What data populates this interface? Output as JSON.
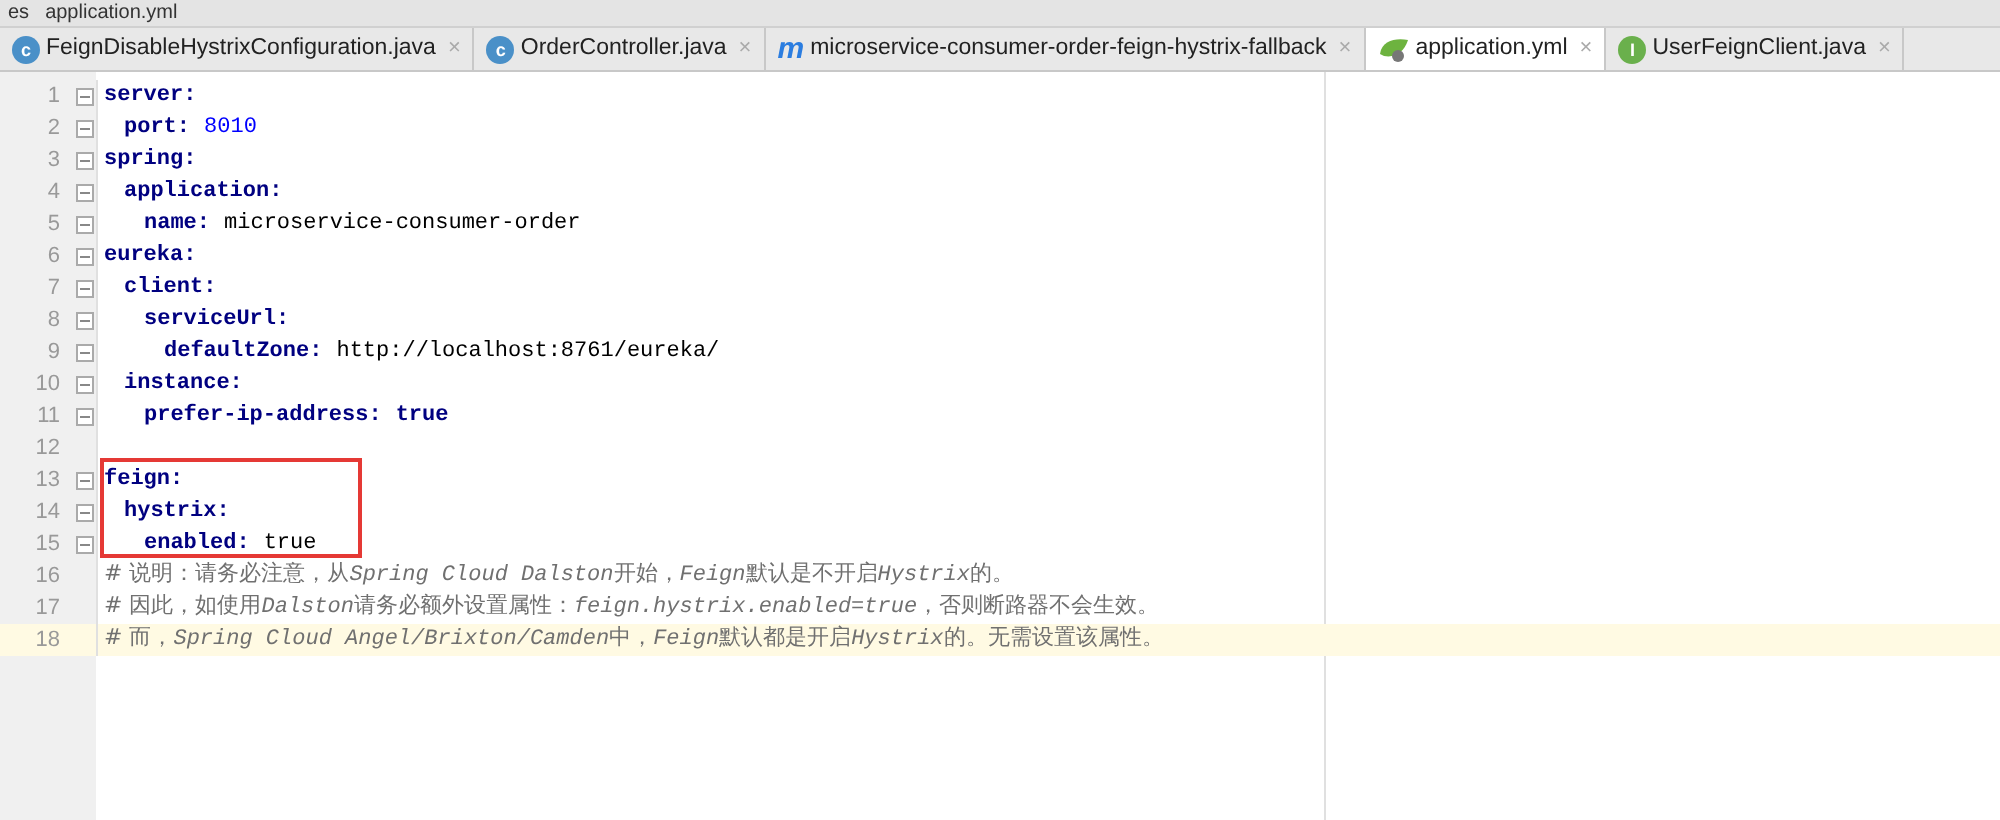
{
  "breadcrumb": [
    "es",
    "application.yml"
  ],
  "tabs": [
    {
      "label": "FeignDisableHystrixConfiguration.java",
      "kind": "class",
      "icon_text": "c",
      "close": "×",
      "selected": false
    },
    {
      "label": "OrderController.java",
      "kind": "class",
      "icon_text": "c",
      "close": "×",
      "selected": false
    },
    {
      "label": "microservice-consumer-order-feign-hystrix-fallback",
      "kind": "module",
      "icon_text": "m",
      "close": "×",
      "selected": false
    },
    {
      "label": "application.yml",
      "kind": "yml",
      "close": "×",
      "selected": true
    },
    {
      "label": "UserFeignClient.java",
      "kind": "interface",
      "icon_text": "I",
      "close": "×",
      "selected": false
    }
  ],
  "code": [
    {
      "kind": "node",
      "number": "1",
      "key": "server:",
      "current": false,
      "highlighted": false,
      "children": [
        {
          "kind": "node",
          "number": "2",
          "key": "port:",
          "value": {
            "text": "8010",
            "kind": "number"
          },
          "current": false
        }
      ]
    },
    {
      "kind": "node",
      "number": "3",
      "key": "spring:",
      "current": false,
      "highlighted": false,
      "children": [
        {
          "kind": "node",
          "number": "4",
          "key": "application:",
          "current": false,
          "children": [
            {
              "kind": "node",
              "number": "5",
              "key": "name:",
              "value": {
                "text": "microservice-consumer-order",
                "kind": "plain"
              },
              "current": false
            }
          ]
        }
      ]
    },
    {
      "kind": "node",
      "number": "6",
      "key": "eureka:",
      "current": false,
      "highlighted": false,
      "children": [
        {
          "kind": "node",
          "number": "7",
          "key": "client:",
          "current": false,
          "children": [
            {
              "kind": "node",
              "number": "8",
              "key": "serviceUrl:",
              "current": false,
              "children": [
                {
                  "kind": "node",
                  "number": "9",
                  "key": "defaultZone:",
                  "value": {
                    "text": "http://localhost:8761/eureka/",
                    "kind": "plain"
                  },
                  "current": false
                }
              ]
            }
          ]
        },
        {
          "kind": "node",
          "number": "10",
          "key": "instance:",
          "current": false,
          "children": [
            {
              "kind": "node",
              "number": "11",
              "key": "prefer-ip-address:",
              "value": {
                "text": "true",
                "kind": "keyword"
              },
              "current": false
            }
          ]
        }
      ]
    },
    {
      "kind": "blank",
      "number": "12",
      "current": false,
      "highlighted": false
    },
    {
      "kind": "node",
      "number": "13",
      "key": "feign:",
      "current": false,
      "highlighted": true,
      "children": [
        {
          "kind": "node",
          "number": "14",
          "key": "hystrix:",
          "current": false,
          "children": [
            {
              "kind": "node",
              "number": "15",
              "key": "enabled:",
              "value": {
                "text": "true",
                "kind": "plain"
              },
              "current": false
            }
          ]
        }
      ]
    },
    {
      "kind": "comment",
      "number": "16",
      "segments": [
        {
          "text": "# 说明：请务必注意，从",
          "italic": false
        },
        {
          "text": "Spring Cloud Dalston",
          "italic": true
        },
        {
          "text": "开始，",
          "italic": false
        },
        {
          "text": "Feign",
          "italic": true
        },
        {
          "text": "默认是不开启",
          "italic": false
        },
        {
          "text": "Hystrix",
          "italic": true
        },
        {
          "text": "的。",
          "italic": false
        }
      ],
      "current": false,
      "highlighted": false
    },
    {
      "kind": "comment",
      "number": "17",
      "segments": [
        {
          "text": "# 因此，如使用",
          "italic": false
        },
        {
          "text": "Dalston",
          "italic": true
        },
        {
          "text": "请务必额外设置属性：",
          "italic": false
        },
        {
          "text": "feign.hystrix.enabled=true",
          "italic": true
        },
        {
          "text": "，否则断路器不会生效。",
          "italic": false
        }
      ],
      "current": false,
      "highlighted": false
    },
    {
      "kind": "comment",
      "number": "18",
      "segments": [
        {
          "text": "# 而，",
          "italic": false
        },
        {
          "text": "Spring Cloud Angel/Brixton/Camden",
          "italic": true
        },
        {
          "text": "中，",
          "italic": false
        },
        {
          "text": "Feign",
          "italic": true
        },
        {
          "text": "默认都是开启",
          "italic": false
        },
        {
          "text": "Hystrix",
          "italic": true
        },
        {
          "text": "的。无需设置该属性。",
          "italic": false
        }
      ],
      "current": true,
      "highlighted": false
    }
  ]
}
